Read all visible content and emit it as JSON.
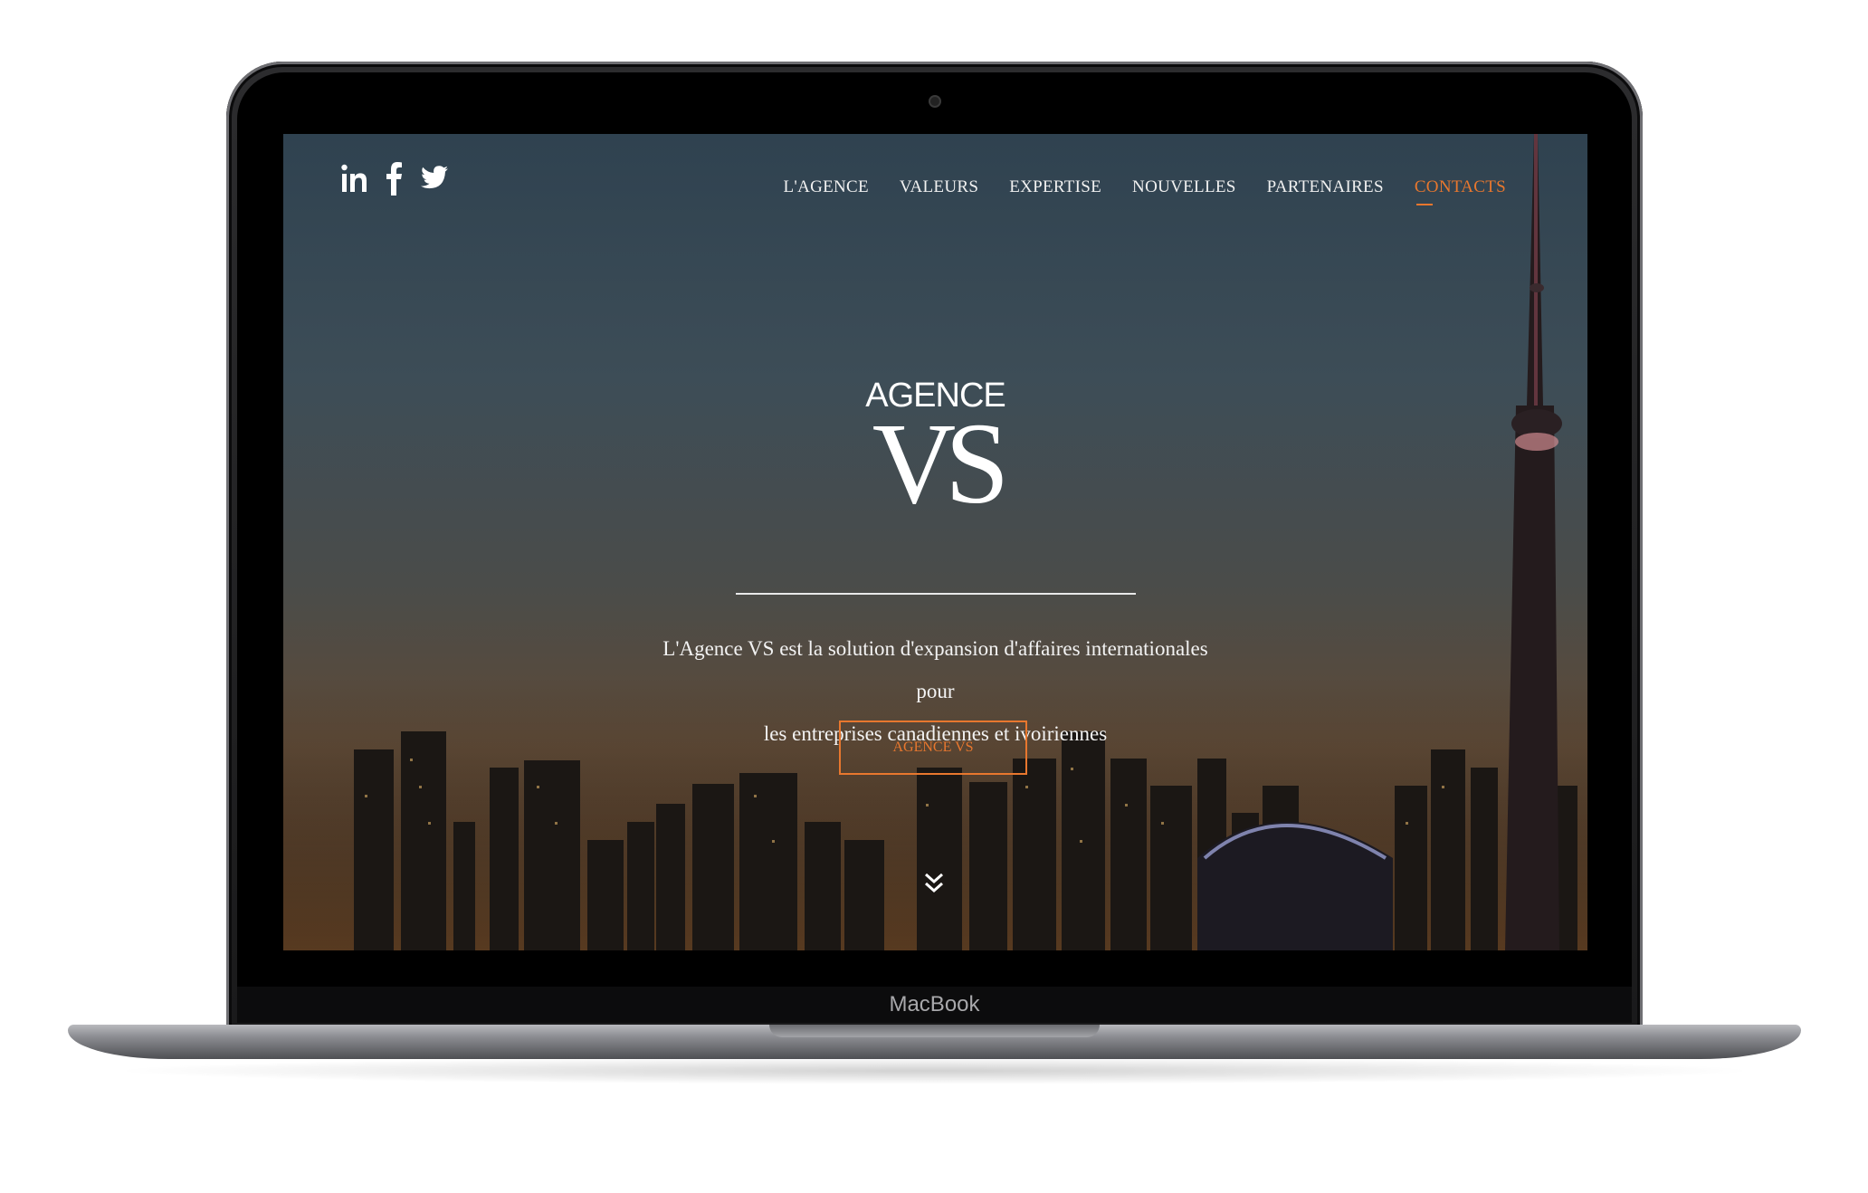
{
  "device": {
    "brand_label": "MacBook"
  },
  "social": [
    {
      "name": "linkedin",
      "icon": "linkedin-icon"
    },
    {
      "name": "facebook",
      "icon": "facebook-icon"
    },
    {
      "name": "twitter",
      "icon": "twitter-icon"
    }
  ],
  "nav": {
    "items": [
      "L'AGENCE",
      "VALEURS",
      "EXPERTISE",
      "NOUVELLES",
      "PARTENAIRES",
      "CONTACTS"
    ],
    "active": "CONTACTS"
  },
  "hero": {
    "logo_top": "AGENCE",
    "logo_main": "VS",
    "tagline_line1": "L'Agence VS est la solution d'expansion d'affaires internationales pour",
    "tagline_line2": "les entreprises canadiennes et ivoiriennes",
    "cta_label": "AGENCE VS",
    "scroll_icon": "double-chevron-down-icon"
  },
  "colors": {
    "accent": "#e8772e",
    "text": "#ffffff",
    "screen_top": "#2f4250",
    "screen_bottom": "#3b2a1d"
  }
}
